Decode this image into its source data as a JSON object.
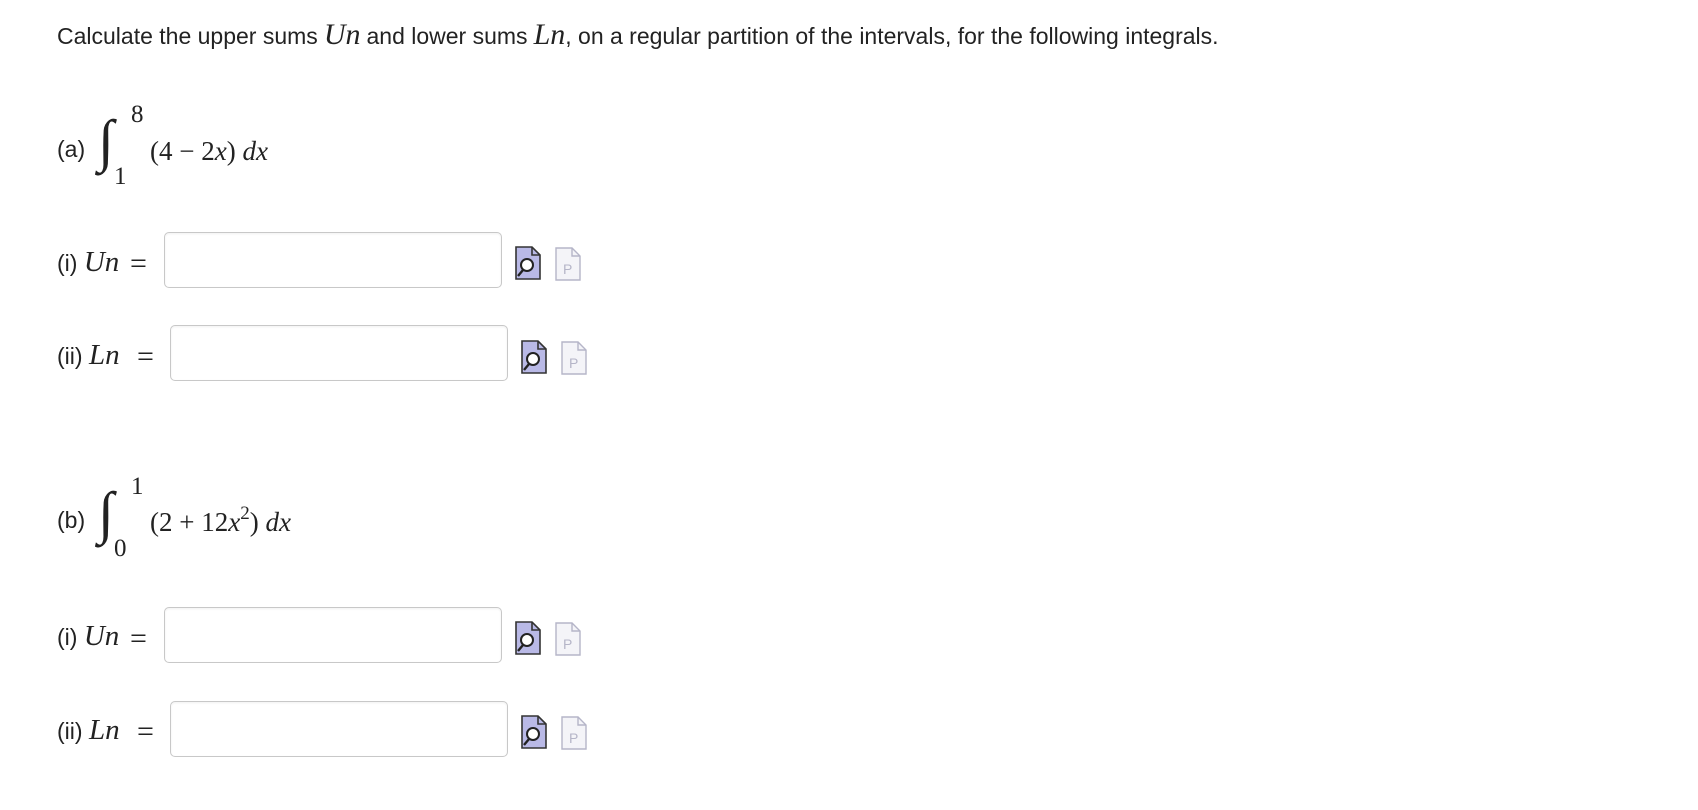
{
  "instructions": {
    "text_before_un": "Calculate the upper sums",
    "un_symbol": "Un",
    "text_between": "and lower sums",
    "ln_symbol": "Ln",
    "text_after": ", on a regular partition of the intervals, for the following integrals."
  },
  "parts": [
    {
      "label": "(a)",
      "upper_limit": "8",
      "lower_limit": "1",
      "integrand_open": "(4 − 2",
      "integrand_var": "x",
      "integrand_close": ")",
      "integrand_power": "",
      "integrand_dx": "dx",
      "rows": [
        {
          "label": "(i)",
          "symbol": "Un",
          "equals": "=",
          "value": "",
          "placeholder": ""
        },
        {
          "label": "(ii)",
          "symbol": "Ln",
          "equals": "=",
          "value": "",
          "placeholder": ""
        }
      ]
    },
    {
      "label": "(b)",
      "upper_limit": "1",
      "lower_limit": "0",
      "integrand_open": "(2 + 12",
      "integrand_var": "x",
      "integrand_close": ")",
      "integrand_power": "2",
      "integrand_dx": "dx",
      "rows": [
        {
          "label": "(i)",
          "symbol": "Un",
          "equals": "=",
          "value": "",
          "placeholder": ""
        },
        {
          "label": "(ii)",
          "symbol": "Ln",
          "equals": "=",
          "value": "",
          "placeholder": ""
        }
      ]
    }
  ],
  "icons": {
    "preview": "preview-magnifier-icon",
    "palette": "math-palette-icon",
    "preview_color": "#b9b9e6",
    "palette_color": "#b5b5c8"
  }
}
